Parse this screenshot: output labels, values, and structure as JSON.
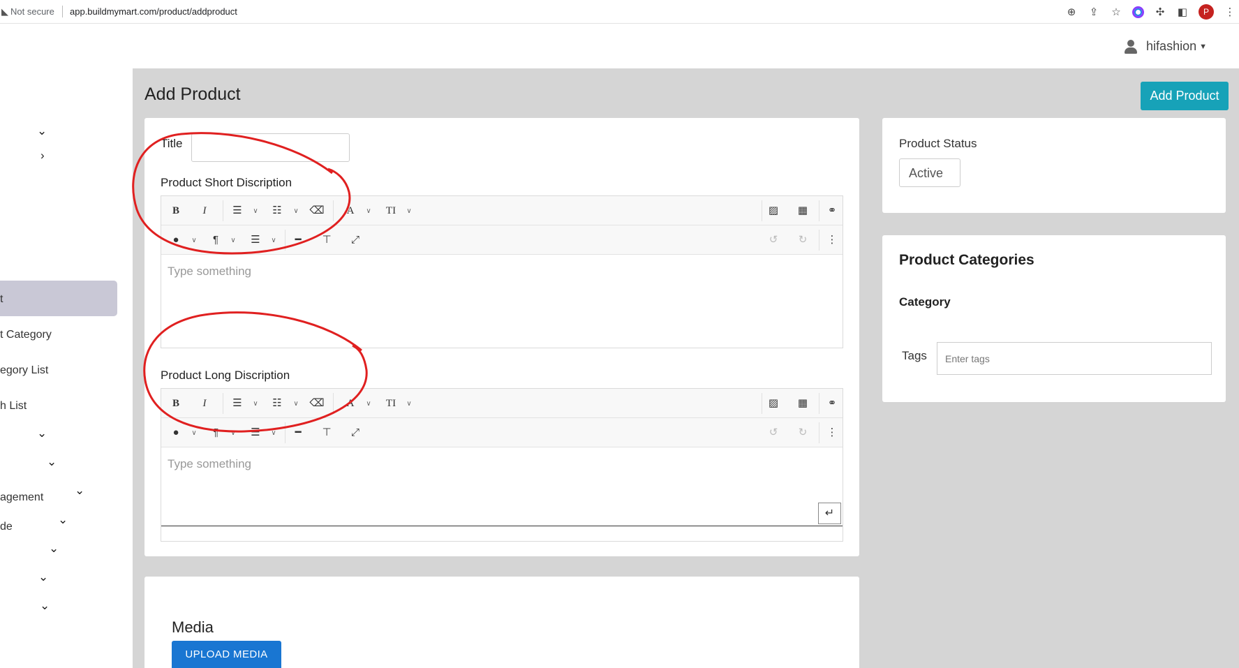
{
  "browser": {
    "security_label": "Not secure",
    "url": "app.buildmymart.com/product/addproduct",
    "profile_initial": "P"
  },
  "header": {
    "username": "hifashion"
  },
  "sidebar": {
    "items": [
      {
        "label": "t"
      },
      {
        "label": "t Category"
      },
      {
        "label": "egory List"
      },
      {
        "label": "h List"
      },
      {
        "label": "agement"
      },
      {
        "label": "de"
      }
    ]
  },
  "page": {
    "title": "Add Product",
    "add_button": "Add Product"
  },
  "form": {
    "title_label": "Title",
    "short_desc_label": "Product Short Discription",
    "long_desc_label": "Product Long Discription",
    "editor_placeholder": "Type something"
  },
  "status": {
    "label": "Product Status",
    "value": "Active"
  },
  "categories": {
    "heading": "Product Categories",
    "category_label": "Category",
    "tags_label": "Tags",
    "tags_placeholder": "Enter tags"
  },
  "media": {
    "heading": "Media",
    "upload_button": "UPLOAD MEDIA"
  },
  "annotation": {
    "color": "#e02020"
  }
}
